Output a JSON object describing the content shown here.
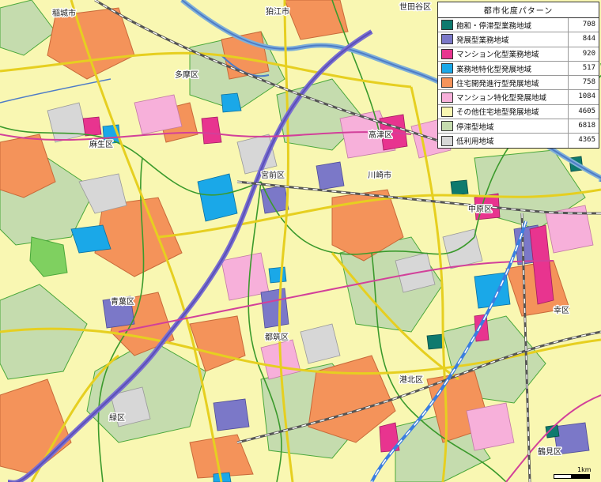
{
  "legend": {
    "title": "都市化度パターン",
    "items": [
      {
        "label": "飽和・停滞型業務地域",
        "count": "708",
        "color": "#0e7a6e"
      },
      {
        "label": "発展型業務地域",
        "count": "844",
        "color": "#7b78c8"
      },
      {
        "label": "マンション化型業務地域",
        "count": "920",
        "color": "#e8348f"
      },
      {
        "label": "業務地特化型発展地域",
        "count": "517",
        "color": "#1aa8e8"
      },
      {
        "label": "住宅開発進行型発展地域",
        "count": "758",
        "color": "#f4935a"
      },
      {
        "label": "マンション特化型発展地域",
        "count": "1084",
        "color": "#f7b0da"
      },
      {
        "label": "その他住宅地型発展地域",
        "count": "4605",
        "color": "#f9f7b2"
      },
      {
        "label": "停滞型地域",
        "count": "6818",
        "color": "#c5dcae"
      },
      {
        "label": "低利用地域",
        "count": "4365",
        "color": "#d7d7d7"
      }
    ]
  },
  "places": [
    {
      "id": "inagi",
      "name": "稲城市"
    },
    {
      "id": "komae",
      "name": "狛江市"
    },
    {
      "id": "setagaya",
      "name": "世田谷区"
    },
    {
      "id": "tama",
      "name": "多摩区"
    },
    {
      "id": "asao",
      "name": "麻生区"
    },
    {
      "id": "takatsu",
      "name": "高津区"
    },
    {
      "id": "miyamae",
      "name": "宮前区"
    },
    {
      "id": "kawasaki",
      "name": "川崎市"
    },
    {
      "id": "nakahara",
      "name": "中原区"
    },
    {
      "id": "aoba",
      "name": "青葉区"
    },
    {
      "id": "tsuzuki",
      "name": "都筑区"
    },
    {
      "id": "kohoku",
      "name": "港北区"
    },
    {
      "id": "midori",
      "name": "緑区"
    },
    {
      "id": "kohoku2",
      "name": "幸区"
    },
    {
      "id": "tsurumi",
      "name": "鶴見区"
    }
  ],
  "scale": {
    "label": "1km"
  }
}
